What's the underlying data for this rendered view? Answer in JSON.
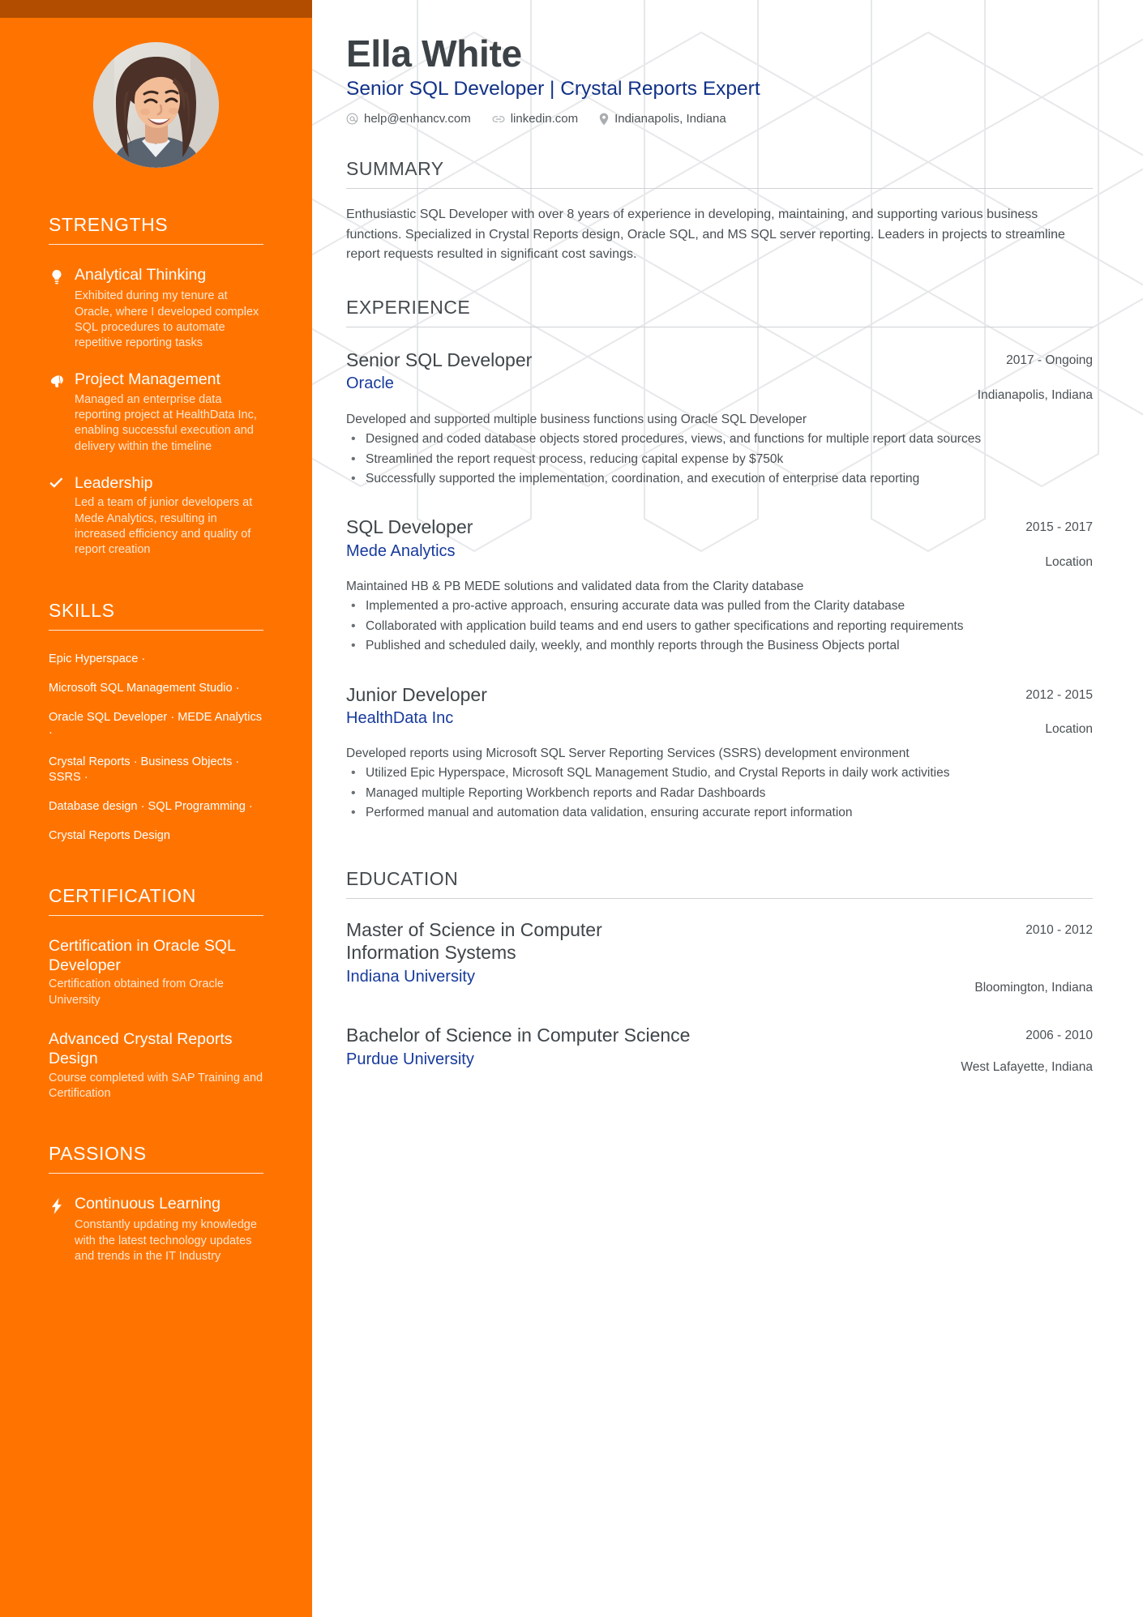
{
  "colors": {
    "sidebar_bg": "#FF7400",
    "sidebar_top_stripe": "#B24D00",
    "accent_link": "#173A9C",
    "heading_text": "#454B4F",
    "body_text": "#4A5054"
  },
  "header": {
    "name": "Ella White",
    "headline": "Senior SQL Developer | Crystal Reports Expert",
    "contacts": [
      {
        "icon": "at-icon",
        "text": "help@enhancv.com"
      },
      {
        "icon": "link-icon",
        "text": "linkedin.com"
      },
      {
        "icon": "location-pin-icon",
        "text": "Indianapolis, Indiana"
      }
    ]
  },
  "sidebar": {
    "strengths": {
      "heading": "STRENGTHS",
      "items": [
        {
          "icon": "lightbulb-icon",
          "title": "Analytical Thinking",
          "description": "Exhibited during my tenure at Oracle, where I developed complex SQL procedures to automate repetitive reporting tasks"
        },
        {
          "icon": "megaphone-icon",
          "title": "Project Management",
          "description": "Managed an enterprise data reporting project at HealthData Inc, enabling successful execution and delivery within the timeline"
        },
        {
          "icon": "checkmark-icon",
          "title": "Leadership",
          "description": "Led a team of junior developers at Mede Analytics, resulting in increased efficiency and quality of report creation"
        }
      ]
    },
    "skills": {
      "heading": "SKILLS",
      "lines": [
        "Epic Hyperspace ·",
        "Microsoft SQL Management Studio ·",
        "Oracle SQL Developer · MEDE Analytics ·",
        "Crystal Reports · Business Objects · SSRS ·",
        "Database design · SQL Programming ·",
        "Crystal Reports Design"
      ]
    },
    "certification": {
      "heading": "CERTIFICATION",
      "items": [
        {
          "title": "Certification in Oracle SQL Developer",
          "description": "Certification obtained from Oracle University"
        },
        {
          "title": "Advanced Crystal Reports Design",
          "description": "Course completed with SAP Training and Certification"
        }
      ]
    },
    "passions": {
      "heading": "PASSIONS",
      "items": [
        {
          "icon": "lightning-bolt-icon",
          "title": "Continuous Learning",
          "description": "Constantly updating my knowledge with the latest technology updates and trends in the IT Industry"
        }
      ]
    }
  },
  "main": {
    "summary": {
      "heading": "SUMMARY",
      "text": "Enthusiastic SQL Developer with over 8 years of experience in developing, maintaining, and supporting various business functions. Specialized in Crystal Reports design, Oracle SQL, and MS SQL server reporting. Leaders in projects to streamline report requests resulted in significant cost savings."
    },
    "experience": {
      "heading": "EXPERIENCE",
      "entries": [
        {
          "title": "Senior SQL Developer",
          "organization": "Oracle",
          "date": "2017 - Ongoing",
          "location": "Indianapolis, Indiana",
          "summary": "Developed and supported multiple business functions using Oracle SQL Developer",
          "bullets": [
            "Designed and coded database objects stored procedures, views, and functions for multiple report data sources",
            "Streamlined the report request process, reducing capital expense by $750k",
            "Successfully supported the implementation, coordination, and execution of enterprise data reporting"
          ]
        },
        {
          "title": "SQL Developer",
          "organization": "Mede Analytics",
          "date": "2015 - 2017",
          "location": "Location",
          "summary": "Maintained HB & PB MEDE solutions and validated data from the Clarity database",
          "bullets": [
            "Implemented a pro-active approach, ensuring accurate data was pulled from the Clarity database",
            "Collaborated with application build teams and end users to gather specifications and reporting requirements",
            "Published and scheduled daily, weekly, and monthly reports through the Business Objects portal"
          ]
        },
        {
          "title": "Junior Developer",
          "organization": "HealthData Inc",
          "date": "2012 - 2015",
          "location": "Location",
          "summary": "Developed reports using Microsoft SQL Server Reporting Services (SSRS) development environment",
          "bullets": [
            "Utilized Epic Hyperspace, Microsoft SQL Management Studio, and Crystal Reports in daily work activities",
            "Managed multiple Reporting Workbench reports and Radar Dashboards",
            "Performed manual and automation data validation, ensuring accurate report information"
          ]
        }
      ]
    },
    "education": {
      "heading": "EDUCATION",
      "entries": [
        {
          "title": "Master of Science in Computer Information Systems",
          "organization": "Indiana University",
          "date": "2010 - 2012",
          "location": "Bloomington, Indiana"
        },
        {
          "title": "Bachelor of Science in Computer Science",
          "organization": "Purdue University",
          "date": "2006 - 2010",
          "location": "West Lafayette, Indiana"
        }
      ]
    }
  }
}
